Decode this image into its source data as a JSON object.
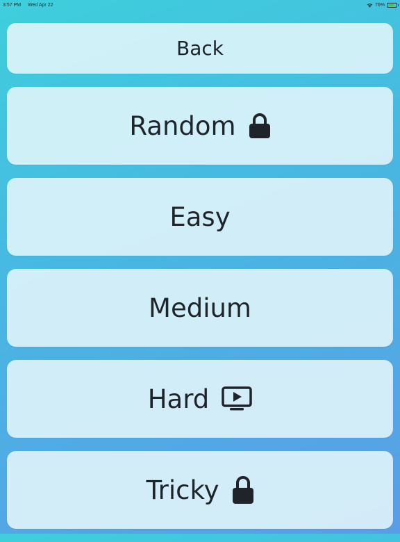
{
  "status": {
    "time": "3:57 PM",
    "date": "Wed Apr 22",
    "battery": "76%",
    "battery_level": 0.76
  },
  "menu": {
    "back_label": "Back",
    "levels": [
      {
        "label": "Random",
        "icon": "lock-icon"
      },
      {
        "label": "Easy",
        "icon": ""
      },
      {
        "label": "Medium",
        "icon": ""
      },
      {
        "label": "Hard",
        "icon": "tv-play-icon"
      },
      {
        "label": "Tricky",
        "icon": "lock-icon"
      }
    ]
  },
  "colors": {
    "text": "#1f242a",
    "button_bg": "#e4f6fa",
    "gradient_start": "#3ecfdc",
    "gradient_end": "#5a9de6"
  }
}
